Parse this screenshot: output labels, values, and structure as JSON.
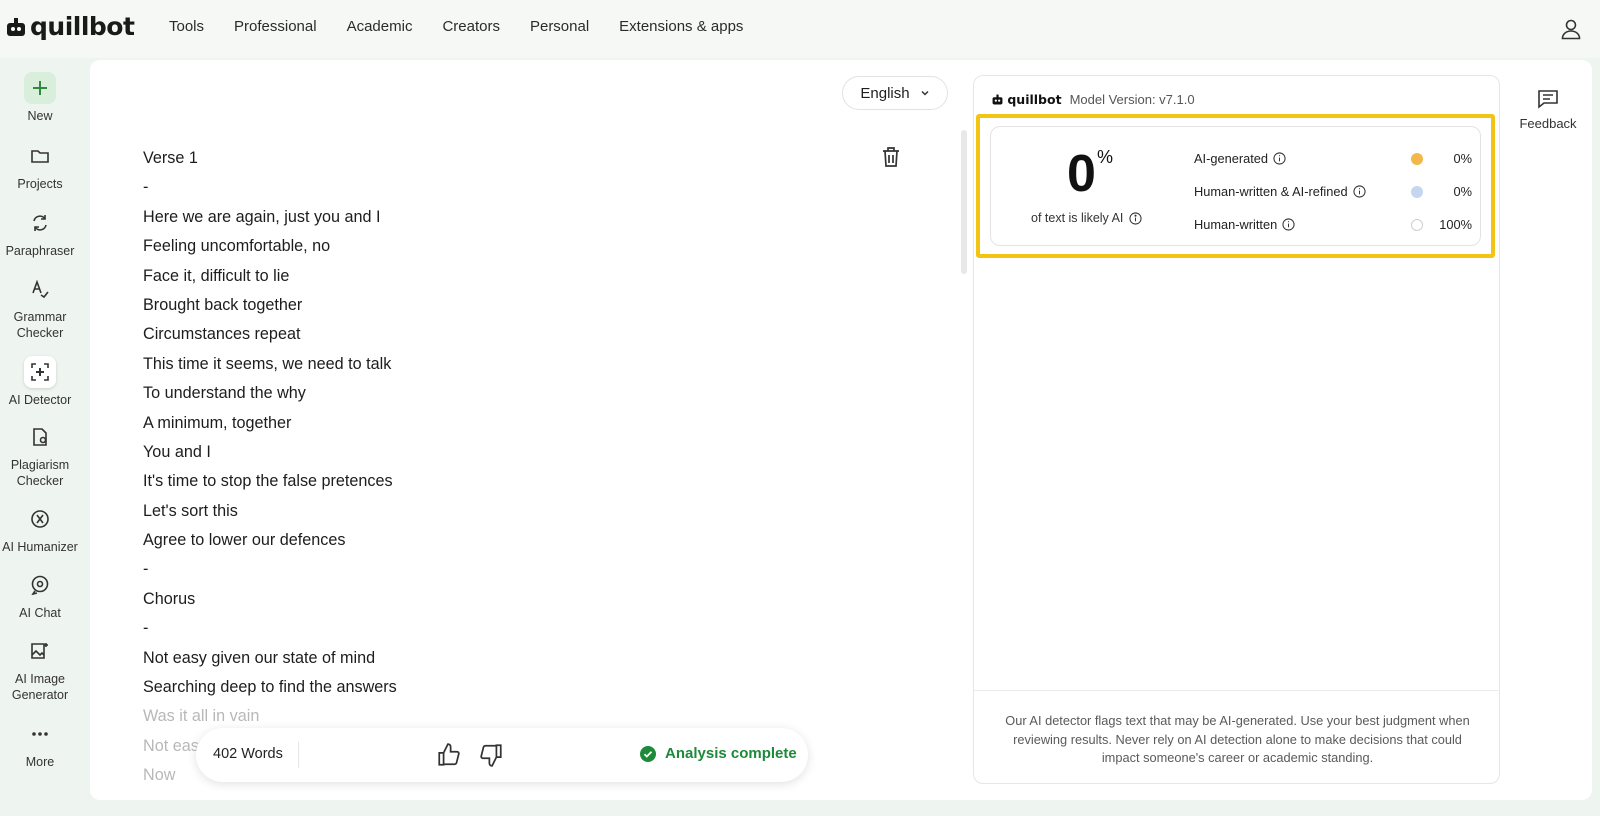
{
  "brand": {
    "name": "quillbot"
  },
  "nav": {
    "items": [
      "Tools",
      "Professional",
      "Academic",
      "Creators",
      "Personal",
      "Extensions & apps"
    ]
  },
  "sidebar": {
    "items": [
      {
        "label": "New",
        "icon": "plus-icon"
      },
      {
        "label": "Projects",
        "icon": "folder-icon"
      },
      {
        "label": "Paraphraser",
        "icon": "paraphraser-icon"
      },
      {
        "label": "Grammar Checker",
        "icon": "grammar-icon"
      },
      {
        "label": "AI Detector",
        "icon": "ai-detector-icon"
      },
      {
        "label": "Plagiarism Checker",
        "icon": "plagiarism-icon"
      },
      {
        "label": "AI Humanizer",
        "icon": "humanizer-icon"
      },
      {
        "label": "AI Chat",
        "icon": "chat-icon"
      },
      {
        "label": "AI Image Generator",
        "icon": "image-generator-icon"
      },
      {
        "label": "More",
        "icon": "more-icon"
      }
    ]
  },
  "editor": {
    "language": "English",
    "lines": [
      "Verse 1",
      "-",
      "Here we are again, just you and I",
      "Feeling uncomfortable, no",
      "Face it, difficult to lie",
      "Brought back together",
      "Circumstances repeat",
      "This time it seems, we need to talk",
      "To understand the why",
      "A minimum, together",
      "You and I",
      "It's time to stop the false pretences",
      "Let's sort this",
      "Agree to lower our defences",
      "-",
      "Chorus",
      "-",
      "Not easy given our state of mind",
      "Searching deep to find the answers",
      "Was it all in vain",
      "Not easy",
      "Now"
    ],
    "word_count": "402 Words",
    "status": "Analysis complete"
  },
  "results": {
    "brand": "quillbot",
    "model_version": "Model Version: v7.1.0",
    "score": "0",
    "score_unit": "%",
    "score_caption": "of text is likely AI",
    "rows": [
      {
        "label": "AI-generated",
        "value": "0%",
        "color": "#f2b94a"
      },
      {
        "label": "Human-written & AI-refined",
        "value": "0%",
        "color": "#c5d6f0"
      },
      {
        "label": "Human-written",
        "value": "100%",
        "color": "#ffffff"
      }
    ],
    "disclaimer": "Our AI detector flags text that may be AI-generated. Use your best judgment when reviewing results. Never rely on AI detection alone to make decisions that could impact someone's career or academic standing."
  },
  "feedback": {
    "label": "Feedback"
  },
  "colors": {
    "highlight": "#f2c413",
    "success": "#1d8a3a",
    "accent_green": "#2e8b3e"
  }
}
